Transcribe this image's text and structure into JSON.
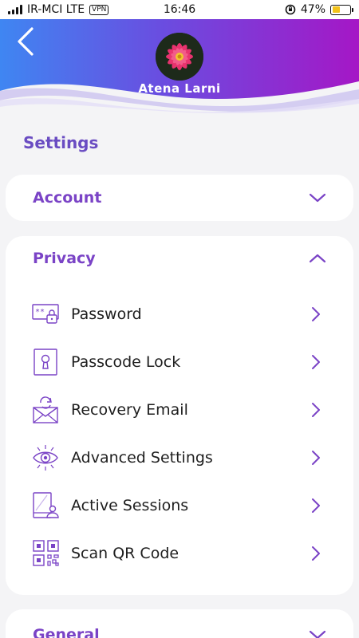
{
  "status_bar": {
    "carrier": "IR-MCI LTE",
    "vpn": "VPN",
    "time": "16:46",
    "battery": "47%",
    "battery_level": 0.47
  },
  "header": {
    "user_name": "Atena Larni",
    "gradient_left": "#3a86f3",
    "gradient_right": "#a017c9"
  },
  "page": {
    "title": "Settings"
  },
  "sections": {
    "account": {
      "title": "Account"
    },
    "privacy": {
      "title": "Privacy",
      "items": [
        {
          "label": "Password",
          "icon": "password-icon"
        },
        {
          "label": "Passcode Lock",
          "icon": "passcode-lock-icon"
        },
        {
          "label": "Recovery Email",
          "icon": "recovery-email-icon"
        },
        {
          "label": "Advanced Settings",
          "icon": "advanced-settings-icon"
        },
        {
          "label": "Active Sessions",
          "icon": "active-sessions-icon"
        },
        {
          "label": "Scan QR Code",
          "icon": "qr-code-icon"
        }
      ]
    },
    "general": {
      "title": "General"
    }
  },
  "colors": {
    "accent": "#7a43c6",
    "title": "#6a4cc2"
  }
}
